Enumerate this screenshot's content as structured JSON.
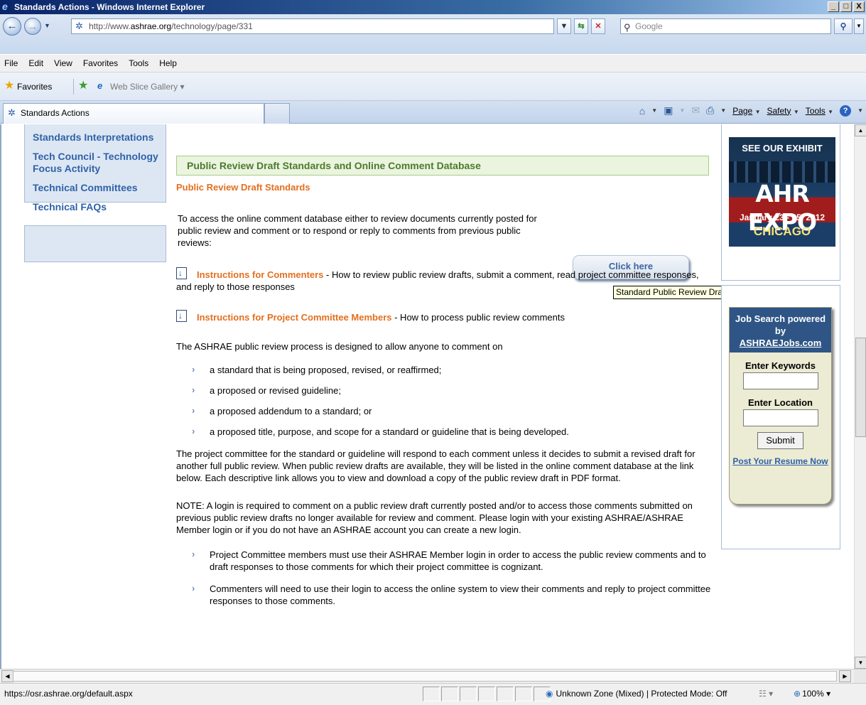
{
  "window": {
    "title": "Standards Actions - Windows Internet Explorer",
    "controls": [
      "_",
      "□",
      "X"
    ]
  },
  "address": {
    "url_prefix": "http://www.",
    "url_host": "ashrae.org",
    "url_path": "/technology/page/331",
    "search_placeholder": "Google"
  },
  "menu": [
    "File",
    "Edit",
    "View",
    "Favorites",
    "Tools",
    "Help"
  ],
  "favorites": {
    "label": "Favorites",
    "web_slice": "Web Slice Gallery ▾"
  },
  "tab": {
    "title": "Standards Actions"
  },
  "commandbar": {
    "page": "Page",
    "safety": "Safety",
    "tools": "Tools"
  },
  "leftnav": [
    "Standards Interpretations",
    "Tech Council - Technology Focus Activity",
    "Technical Committees",
    "Technical FAQs"
  ],
  "main": {
    "heading": "Public Review Draft Standards and Online Comment Database",
    "subheading": "Public Review Draft Standards",
    "access_text": "To access the online comment database either to review documents currently posted for public review and comment or to respond or reply to comments from previous public reviews:",
    "click_button": "Click here",
    "tooltip": "Standard Public Review Drafts Click Here",
    "instr1_link": "Instructions for Commenters",
    "instr1_text": " - How to review public review drafts, submit a comment, read project committee responses, and reply to those responses",
    "instr2_link": "Instructions for Project Committee Members",
    "instr2_text": " - How to process public review comments",
    "process_intro": "The ASHRAE public review process is designed to allow anyone to comment on",
    "process_items": [
      "a standard that is being proposed, revised, or reaffirmed;",
      "a proposed or revised guideline;",
      "a proposed addendum to a standard; or",
      "a proposed title, purpose, and scope for a standard or guideline that is being developed."
    ],
    "committee_para": "The project committee for the standard or guideline will respond to each comment unless it decides to submit a revised draft for another full public review. When public review drafts are available, they will be listed in the online comment database at the link below. Each descriptive link allows you to view and download a copy of the public review draft in PDF format.",
    "note_para": "NOTE: A login is required to comment on a public review draft currently posted and/or to access those comments submitted on previous public review drafts no longer available for review and comment. Please login with your existing ASHRAE/ASHRAE Member login or if you do not have an ASHRAE account you can create a new login.",
    "login_items": [
      "Project Committee members must use their ASHRAE Member login in order to access the public review comments and to draft responses to those comments for which their project committee is cognizant.",
      "Commenters will need to use their login to access the online system to view their comments and reply to project committee responses to those comments."
    ]
  },
  "ad": {
    "see": "SEE OUR EXHIBIT",
    "brand": "AHR EXPO",
    "dates": "January 23 - 25, 2012",
    "city": "CHICAGO"
  },
  "jobs": {
    "title": "Job Search powered by",
    "link": "ASHRAEJobs.com",
    "keywords_label": "Enter Keywords",
    "location_label": "Enter Location",
    "submit": "Submit",
    "post_resume": "Post Your Resume Now"
  },
  "status": {
    "url": "https://osr.ashrae.org/default.aspx",
    "zone": "Unknown Zone (Mixed) | Protected Mode: Off",
    "zoom": "100%"
  }
}
